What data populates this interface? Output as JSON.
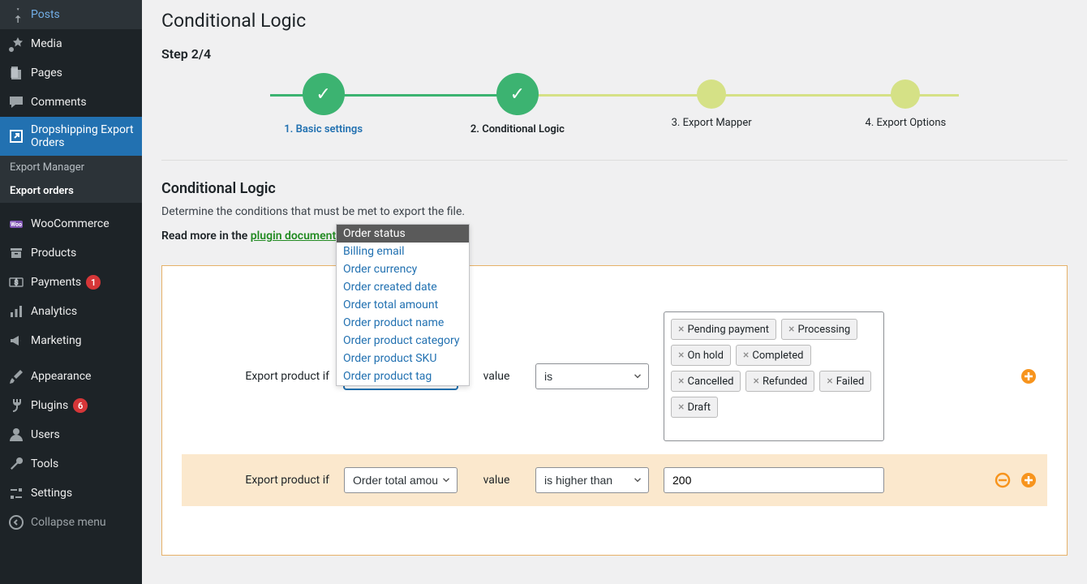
{
  "sidebar": {
    "items": [
      {
        "label": "Posts",
        "icon": "pushpin"
      },
      {
        "label": "Media",
        "icon": "media"
      },
      {
        "label": "Pages",
        "icon": "page"
      },
      {
        "label": "Comments",
        "icon": "comment"
      },
      {
        "label": "Dropshipping Export Orders",
        "icon": "external",
        "active": true,
        "submenu": [
          {
            "label": "Export Manager"
          },
          {
            "label": "Export orders",
            "current": true
          }
        ]
      },
      {
        "separator": true
      },
      {
        "label": "WooCommerce",
        "icon": "woo"
      },
      {
        "label": "Products",
        "icon": "archive"
      },
      {
        "label": "Payments",
        "icon": "payments",
        "badge": "1"
      },
      {
        "label": "Analytics",
        "icon": "chart"
      },
      {
        "label": "Marketing",
        "icon": "megaphone"
      },
      {
        "separator": true
      },
      {
        "label": "Appearance",
        "icon": "brush"
      },
      {
        "label": "Plugins",
        "icon": "plug",
        "badge": "6"
      },
      {
        "label": "Users",
        "icon": "user"
      },
      {
        "label": "Tools",
        "icon": "wrench"
      },
      {
        "label": "Settings",
        "icon": "sliders"
      },
      {
        "label": "Collapse menu",
        "icon": "collapse",
        "collapse": true
      }
    ]
  },
  "page": {
    "title": "Conditional Logic",
    "step_label": "Step 2/4"
  },
  "stepper": {
    "steps": [
      {
        "label": "1. Basic settings",
        "state": "done"
      },
      {
        "label": "2. Conditional Logic",
        "state": "current"
      },
      {
        "label": "3. Export Mapper",
        "state": "future"
      },
      {
        "label": "4. Export Options",
        "state": "future"
      }
    ]
  },
  "section": {
    "title": "Conditional Logic",
    "desc": "Determine the conditions that must be met to export the file.",
    "doc_prefix": "Read more in the ",
    "doc_link": "plugin documentation"
  },
  "dropdown": {
    "options": [
      "Order status",
      "Billing email",
      "Order currency",
      "Order created date",
      "Order total amount",
      "Order product name",
      "Order product category",
      "Order product SKU",
      "Order product tag"
    ],
    "selected": "Order status"
  },
  "rules": {
    "label": "Export product if",
    "value_label": "value",
    "row0": {
      "field": "Order status",
      "condition": "is",
      "tags": [
        "Pending payment",
        "Processing",
        "On hold",
        "Completed",
        "Cancelled",
        "Refunded",
        "Failed",
        "Draft"
      ]
    },
    "row1": {
      "field": "Order total amount",
      "condition": "is higher than",
      "value": "200"
    }
  }
}
